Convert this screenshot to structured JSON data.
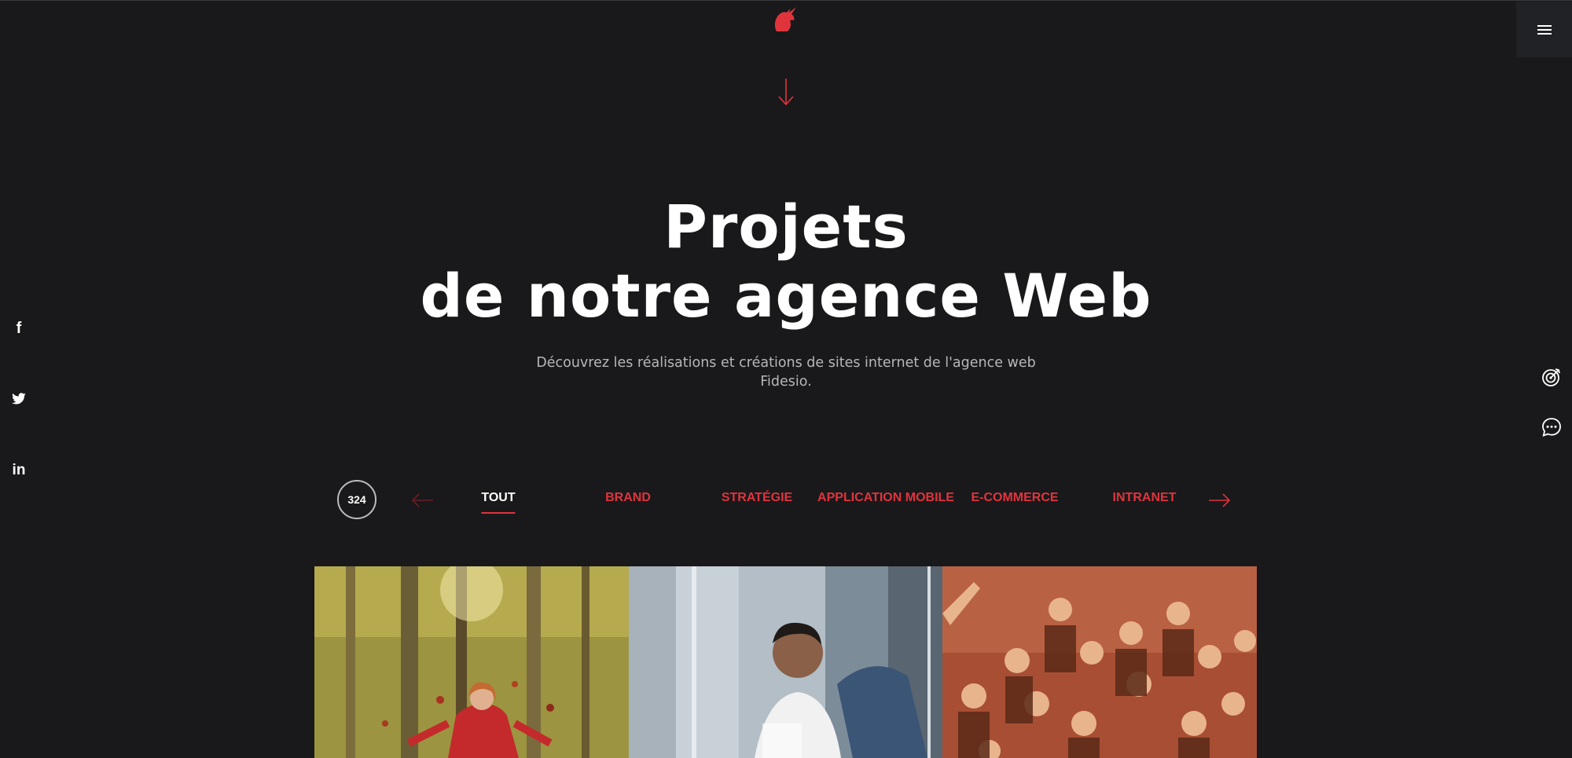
{
  "header": {
    "logo_icon": "unicorn-icon",
    "menu_icon": "hamburger-icon",
    "accent_color": "#e0343d",
    "scroll_icon": "arrow-down-icon"
  },
  "hero": {
    "title_line1": "Projets",
    "title_line2": "de notre agence Web",
    "subtitle_line1": "Découvrez les réalisations et créations de sites internet de l'agence web",
    "subtitle_line2": "Fidesio."
  },
  "social": {
    "facebook": "f",
    "twitter_icon": "twitter-icon",
    "linkedin": "in"
  },
  "side_actions": {
    "target_icon": "target-icon",
    "chat_icon": "chat-bubble-icon"
  },
  "filters": {
    "count": "324",
    "items": [
      {
        "label": "TOUT",
        "active": true
      },
      {
        "label": "BRAND",
        "active": false
      },
      {
        "label": "STRATÉGIE",
        "active": false
      },
      {
        "label": "APPLICATION MOBILE",
        "active": false
      },
      {
        "label": "E-COMMERCE",
        "active": false
      },
      {
        "label": "INTRANET",
        "active": false
      }
    ],
    "prev_icon": "arrow-left-icon",
    "next_icon": "arrow-right-icon"
  },
  "projects": [
    {
      "image": "autumn-forest-woman-photo"
    },
    {
      "image": "office-man-smiling-photo"
    },
    {
      "image": "team-group-photo"
    }
  ]
}
